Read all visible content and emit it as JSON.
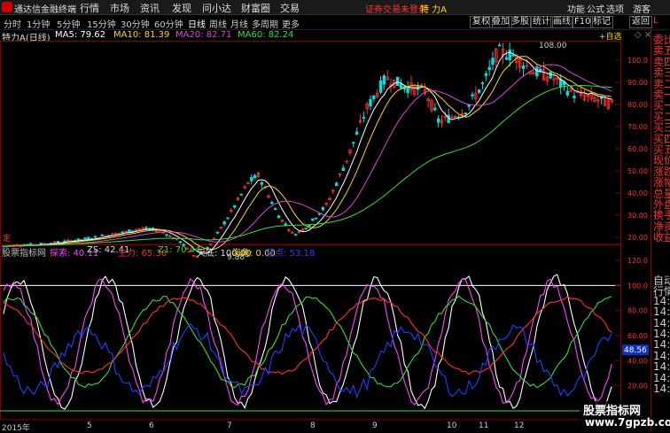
{
  "titlebar": {
    "app_name": "通达信金融终端",
    "menus": [
      "行情",
      "市场",
      "资讯",
      "发现",
      "问小达",
      "财富圈",
      "交易"
    ],
    "warning": "证券交易未登录",
    "security": "特 力A",
    "right_menus": [
      "功能",
      "公式",
      "选项"
    ],
    "guest": "游客"
  },
  "toolbar": {
    "periods": [
      "分时",
      "1分钟",
      "5分钟",
      "15分钟",
      "30分钟",
      "60分钟",
      "日线",
      "周线",
      "月线",
      "多周期",
      "更多"
    ],
    "active_period": "日线",
    "right_buttons": [
      "叠加",
      "画线",
      "F10",
      "标记"
    ],
    "left_right_buttons": [
      "复权",
      "叠加",
      "多股",
      "统计"
    ],
    "add_watch": "+自选",
    "back": "返回"
  },
  "infobar": {
    "name": "特力A(日线)",
    "ma5": "MA5: 79.62",
    "ma10": "MA10: 81.39",
    "ma20": "MA20: 82.71",
    "ma60": "MA60: 82.24"
  },
  "main_chart": {
    "y_ticks": [
      "100.0",
      "90.00",
      "80.00",
      "70.00",
      "60.00",
      "50.00",
      "40.00",
      "30.00",
      "20.00"
    ],
    "high_label": "108.00",
    "low_label": "9.88",
    "ding_label": "定"
  },
  "indicator": {
    "name": "股票指标网",
    "tansuo": "探索: 40.11",
    "zs": "ZS: 42.41",
    "zhuli": "主力: 65.36",
    "z1": "Z1: 70.44",
    "tianyuan": "天底: 100.00",
    "haigui": "海龟: 0.00",
    "lanse": "蓝点: 53.18",
    "y_ticks": [
      "120.0",
      "100.0",
      "80.00",
      "60.00",
      "40.00",
      "20.00"
    ],
    "current": "48.56"
  },
  "dates": [
    "2015年",
    "5",
    "6",
    "7",
    "8",
    "9",
    "10",
    "11",
    "12"
  ],
  "sidepanel": {
    "top_label": "L",
    "items": [
      "委比",
      "卖五",
      "卖四",
      "卖三",
      "卖二",
      "卖一",
      "买一",
      "买二",
      "买三",
      "买四",
      "买五",
      "现价",
      "涨跌",
      "涨幅",
      "总量",
      "外盘",
      "换手",
      "净资",
      "收益"
    ],
    "bottom_items": [
      "自动",
      "行情",
      "14:5",
      "14:5",
      "14:5",
      "14:5",
      "14:5",
      "14:5",
      "14:5",
      "14:5",
      "14:5"
    ]
  },
  "watermark": {
    "line1": "股票指标网",
    "line2": "www.7gpzb.com"
  },
  "colors": {
    "up": "#ff3030",
    "down": "#00e0e0",
    "ma5": "#ffffff",
    "ma10": "#ffd800",
    "ma20": "#e040e0",
    "ma60": "#30e030"
  }
}
